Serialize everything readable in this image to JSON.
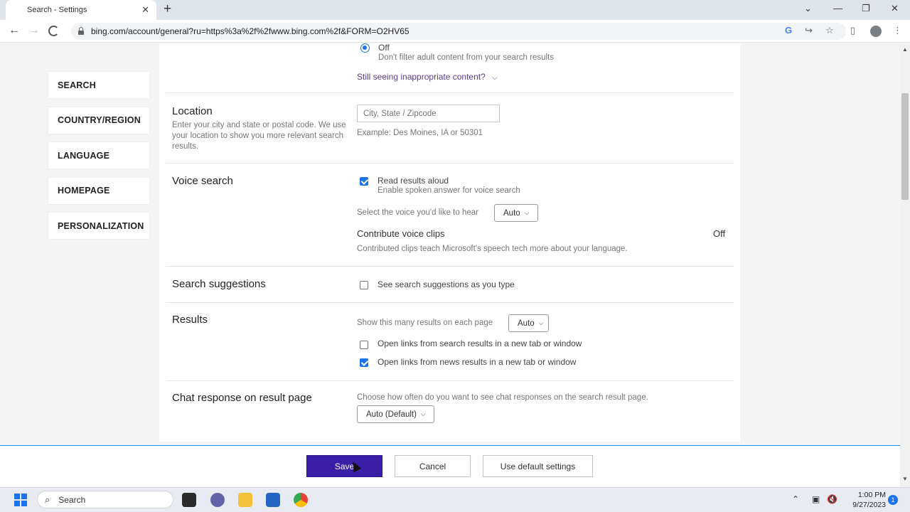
{
  "browser": {
    "tab_title": "Search - Settings",
    "tab_close": "✕",
    "new_tab": "+",
    "url": "bing.com/account/general?ru=https%3a%2f%2fwww.bing.com%2f&FORM=O2HV65"
  },
  "sidebar": {
    "items": [
      {
        "label": "SEARCH"
      },
      {
        "label": "COUNTRY/REGION"
      },
      {
        "label": "LANGUAGE"
      },
      {
        "label": "HOMEPAGE"
      },
      {
        "label": "PERSONALIZATION"
      }
    ]
  },
  "safesearch": {
    "off_label": "Off",
    "off_desc": "Don't filter adult content from your search results",
    "still_seeing": "Still seeing inappropriate content?"
  },
  "location": {
    "title": "Location",
    "desc": "Enter your city and state or postal code. We use your location to show you more relevant search results.",
    "placeholder": "City, State / Zipcode",
    "example": "Example: Des Moines, IA or 50301"
  },
  "voice": {
    "title": "Voice search",
    "read_aloud": "Read results aloud",
    "read_aloud_checked": true,
    "read_aloud_desc": "Enable spoken answer for voice search",
    "voice_select_label": "Select the voice you'd like to hear",
    "voice_select_value": "Auto",
    "contribute_label": "Contribute voice clips",
    "contribute_value": "Off",
    "contribute_desc": "Contributed clips teach Microsoft's speech tech more about your language."
  },
  "suggestions": {
    "title": "Search suggestions",
    "option": "See search suggestions as you type",
    "checked": false
  },
  "results": {
    "title": "Results",
    "count_label": "Show this many results on each page",
    "count_value": "Auto",
    "open_search_new": "Open links from search results in a new tab or window",
    "open_search_new_checked": false,
    "open_news_new": "Open links from news results in a new tab or window",
    "open_news_new_checked": true
  },
  "chat": {
    "title": "Chat response on result page",
    "desc": "Choose how often do you want to see chat responses on the search result page.",
    "value": "Auto (Default)"
  },
  "actions": {
    "save": "Save",
    "cancel": "Cancel",
    "default": "Use default settings"
  },
  "taskbar": {
    "search_label": "Search",
    "time": "1:00 PM",
    "date": "9/27/2023",
    "notifications": "1"
  },
  "colors": {
    "save_button": "#3b1ea7",
    "link": "#5b3c8c",
    "checkbox": "#1a73e8"
  }
}
